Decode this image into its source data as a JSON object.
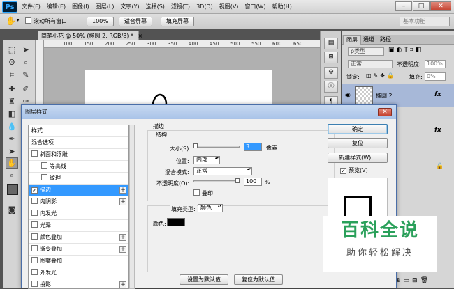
{
  "menubar": {
    "logo": "Ps",
    "items": [
      "文件(F)",
      "编辑(E)",
      "图像(I)",
      "图层(L)",
      "文字(Y)",
      "选择(S)",
      "滤镜(T)",
      "3D(D)",
      "视图(V)",
      "窗口(W)",
      "帮助(H)"
    ],
    "minimize": "–",
    "restore": "□",
    "close": "✕"
  },
  "options": {
    "scroll_all_label": "滚动所有窗口",
    "zoom_100": "100%",
    "fit_screen": "适合屏幕",
    "fill_screen": "填充屏幕",
    "workspace": "基本功能"
  },
  "document": {
    "tab_title": "简笔小花 @ 50% (椭圆 2, RGB/8) *",
    "tab_close": "×",
    "ruler_ticks": [
      "100",
      "150",
      "200",
      "250",
      "300",
      "350",
      "400",
      "450",
      "500",
      "550",
      "600",
      "650"
    ]
  },
  "layers_panel": {
    "tabs": [
      "图层",
      "通道",
      "路径"
    ],
    "kind_label": "ρ类型",
    "blend_mode": "正常",
    "opacity_label": "不透明度:",
    "opacity_value": "100%",
    "lock_label": "锁定:",
    "fill_label": "填充:",
    "fill_value": "0%",
    "layer_name": "椭圆 2",
    "fx": "fx"
  },
  "dialog": {
    "title": "图层样式",
    "close": "✕",
    "styles": [
      {
        "label": "样式",
        "checkbox": false,
        "plus": false,
        "selected": false,
        "indent": 0
      },
      {
        "label": "混合选项",
        "checkbox": false,
        "plus": false,
        "selected": false,
        "indent": 0
      },
      {
        "label": "斜面和浮雕",
        "checkbox": true,
        "plus": false,
        "selected": false,
        "indent": 0
      },
      {
        "label": "等高线",
        "checkbox": true,
        "plus": false,
        "selected": false,
        "indent": 1
      },
      {
        "label": "纹理",
        "checkbox": true,
        "plus": false,
        "selected": false,
        "indent": 1
      },
      {
        "label": "描边",
        "checkbox": true,
        "checked": true,
        "plus": true,
        "selected": true,
        "indent": 0
      },
      {
        "label": "内阴影",
        "checkbox": true,
        "plus": true,
        "selected": false,
        "indent": 0
      },
      {
        "label": "内发光",
        "checkbox": true,
        "plus": false,
        "selected": false,
        "indent": 0
      },
      {
        "label": "光泽",
        "checkbox": true,
        "plus": false,
        "selected": false,
        "indent": 0
      },
      {
        "label": "颜色叠加",
        "checkbox": true,
        "plus": true,
        "selected": false,
        "indent": 0
      },
      {
        "label": "渐变叠加",
        "checkbox": true,
        "plus": true,
        "selected": false,
        "indent": 0
      },
      {
        "label": "图案叠加",
        "checkbox": true,
        "plus": false,
        "selected": false,
        "indent": 0
      },
      {
        "label": "外发光",
        "checkbox": true,
        "plus": false,
        "selected": false,
        "indent": 0
      },
      {
        "label": "投影",
        "checkbox": true,
        "plus": true,
        "selected": false,
        "indent": 0
      }
    ],
    "stroke": {
      "section_title": "描边",
      "structure_title": "结构",
      "size_label": "大小(S):",
      "size_value": "3",
      "size_unit": "像素",
      "position_label": "位置:",
      "position_value": "内部",
      "blend_label": "混合模式:",
      "blend_value": "正常",
      "opacity_label": "不透明度(O):",
      "opacity_value": "100",
      "opacity_unit": "%",
      "emboss_label": "叠印",
      "fill_type_label": "填充类型:",
      "fill_type_value": "颜色",
      "color_label": "颜色:",
      "color_value": "#000000"
    },
    "buttons": {
      "ok": "确定",
      "reset": "复位",
      "new_style": "新建样式(W)...",
      "preview": "预览(V)",
      "set_default": "设置为默认值",
      "reset_default": "复位为默认值"
    }
  },
  "watermark": {
    "title": "百科全说",
    "subtitle": "助你轻松解决"
  }
}
